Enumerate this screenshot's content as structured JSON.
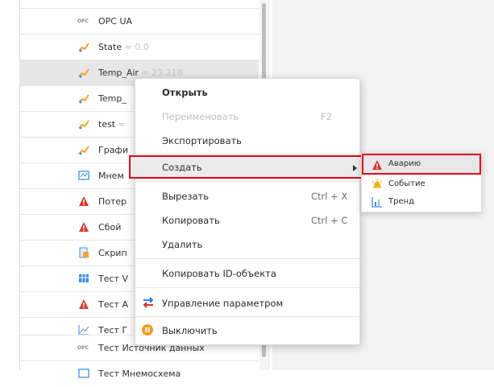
{
  "tree": {
    "items": [
      {
        "label": "OPC UA",
        "value": "",
        "icon": "opc-icon"
      },
      {
        "label": "State",
        "value": "= 0.0",
        "icon": "signal-icon"
      },
      {
        "label": "Temp_Air",
        "value": "= 23.218",
        "icon": "signal-icon"
      },
      {
        "label": "Temp_",
        "value": "",
        "icon": "signal-icon"
      },
      {
        "label": "test",
        "value": "=",
        "icon": "signal-icon"
      },
      {
        "label": "Графи",
        "value": "",
        "icon": "signal-icon"
      },
      {
        "label": "Мнем",
        "value": "",
        "icon": "mnemonic-icon"
      },
      {
        "label": "Потер",
        "value": "",
        "icon": "alarm-icon"
      },
      {
        "label": "Сбой",
        "value": "",
        "icon": "alarm-icon"
      },
      {
        "label": "Скрип",
        "value": "",
        "icon": "script-icon"
      },
      {
        "label": "Тест V",
        "value": "",
        "icon": "table-icon"
      },
      {
        "label": "Тест А",
        "value": "",
        "icon": "alarm-icon"
      },
      {
        "label": "Тест Г",
        "value": "",
        "icon": "chart-icon"
      },
      {
        "label": "Тест Источник данных",
        "value": "",
        "icon": "opc-icon"
      },
      {
        "label": "Тест Мнемосхема",
        "value": "",
        "icon": "mnemonic-icon"
      }
    ]
  },
  "context_menu": {
    "open": "Открыть",
    "rename": "Переименовать",
    "rename_shortcut": "F2",
    "export": "Экспортировать",
    "create": "Создать",
    "cut": "Вырезать",
    "cut_shortcut": "Ctrl + X",
    "copy": "Копировать",
    "copy_shortcut": "Ctrl + C",
    "delete": "Удалить",
    "copy_id": "Копировать ID-объекта",
    "manage_param": "Управление параметром",
    "disable": "Выключить"
  },
  "submenu": {
    "alarm": "Аварию",
    "event": "Событие",
    "trend": "Тренд"
  },
  "colors": {
    "highlight_border": "#e0001b",
    "alarm_red": "#d63a2f",
    "disable_orange": "#f29b1f"
  }
}
